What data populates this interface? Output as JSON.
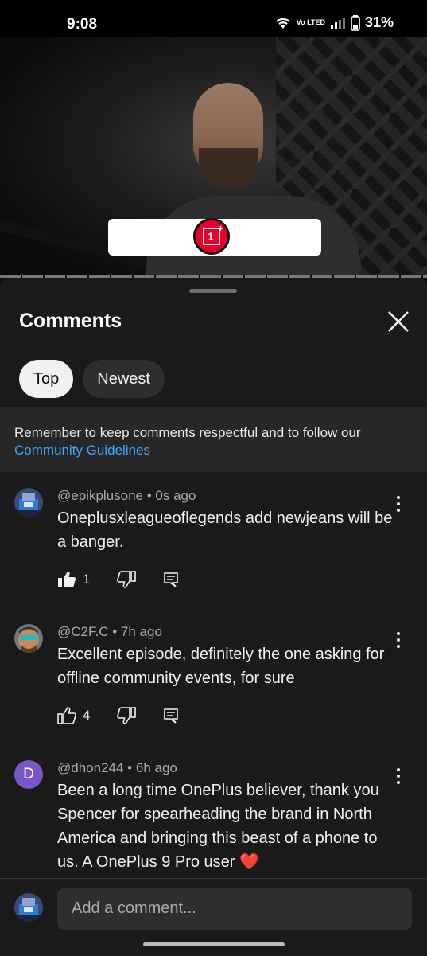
{
  "status_bar": {
    "time": "9:08",
    "network": "Vo LTED",
    "battery": "31%"
  },
  "sheet": {
    "title": "Comments",
    "tabs": [
      {
        "label": "Top",
        "active": true
      },
      {
        "label": "Newest",
        "active": false
      }
    ],
    "notice": {
      "text": "Remember to keep comments respectful and to follow our",
      "link": "Community Guidelines"
    }
  },
  "comments": [
    {
      "author": "@epikplusone",
      "time": "0s ago",
      "text": "Oneplusxleagueoflegends add newjeans will be a banger.",
      "likes": "1",
      "liked": true
    },
    {
      "author": "@C2F.C",
      "time": "7h ago",
      "text": "Excellent episode, definitely the one asking for offline community events, for sure",
      "likes": "4",
      "liked": false
    },
    {
      "author": "@dhon244",
      "time": "6h ago",
      "text": "Been a long time OnePlus believer, thank you Spencer for spearheading the brand in North America and bringing this beast of a phone to us. A OnePlus 9 Pro user ❤️",
      "avatar_letter": "D"
    }
  ],
  "add_comment": {
    "placeholder": "Add a comment..."
  },
  "colors": {
    "background": "#0f0f0f",
    "sheet": "#1a1a1a",
    "link": "#3ea6ff",
    "brand_red": "#eb0029",
    "avatar_d": "#7a57c9"
  }
}
